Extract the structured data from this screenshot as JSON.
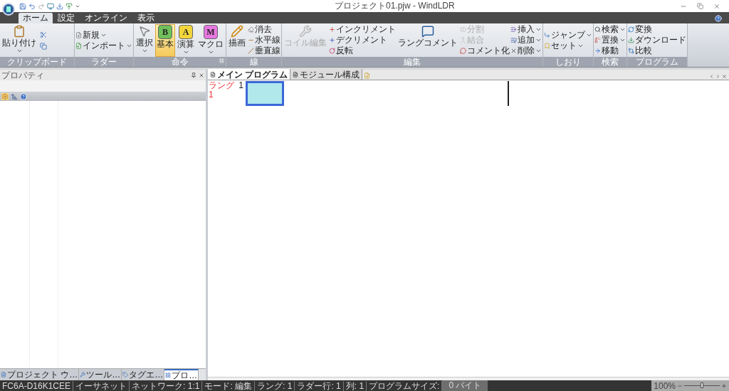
{
  "window": {
    "title": "プロジェクト01.pjw - WindLDR"
  },
  "tabs": [
    {
      "label": "ホーム",
      "selected": true
    },
    {
      "label": "設定",
      "selected": false
    },
    {
      "label": "オンライン",
      "selected": false
    },
    {
      "label": "表示",
      "selected": false
    }
  ],
  "ribbon": [
    {
      "label": "クリップボード",
      "launcher": false,
      "columns": [
        [
          {
            "kind": "large",
            "label": "貼り付け",
            "dropdown": true,
            "disabled": false,
            "selected": false
          }
        ],
        [
          {
            "kind": "icon",
            "disabled": false,
            "selected": false
          },
          {
            "kind": "icon",
            "disabled": false,
            "selected": false
          }
        ]
      ]
    },
    {
      "label": "ラダー",
      "launcher": false,
      "columns": [
        [
          {
            "kind": "small",
            "label": "新規",
            "dropdown": true,
            "disabled": false,
            "selected": false
          },
          {
            "kind": "small",
            "label": "インポート",
            "dropdown": true,
            "disabled": false,
            "selected": false
          }
        ]
      ]
    },
    {
      "label": "命令",
      "launcher": true,
      "columns": [
        [
          {
            "kind": "large",
            "label": "選択",
            "dropdown": true,
            "disabled": false,
            "selected": false
          }
        ],
        [
          {
            "kind": "large",
            "label": "基本",
            "glyph": "B",
            "color": "#6fbf5a",
            "dropdown": false,
            "disabled": false,
            "selected": true
          }
        ],
        [
          {
            "kind": "large",
            "label": "演算",
            "glyph": "A",
            "color": "#f2d53c",
            "dropdown": true,
            "disabled": false,
            "selected": false
          }
        ],
        [
          {
            "kind": "large",
            "label": "マクロ",
            "glyph": "M",
            "color": "#e777e0",
            "dropdown": true,
            "disabled": false,
            "selected": false
          }
        ]
      ]
    },
    {
      "label": "線",
      "launcher": false,
      "columns": [
        [
          {
            "kind": "large",
            "label": "描画",
            "dropdown": false,
            "disabled": false,
            "selected": false
          }
        ],
        [
          {
            "kind": "small",
            "label": "消去",
            "dropdown": false,
            "disabled": false,
            "selected": false
          },
          {
            "kind": "small",
            "label": "水平線",
            "dropdown": false,
            "disabled": false,
            "selected": false
          },
          {
            "kind": "small",
            "label": "垂直線",
            "dropdown": false,
            "disabled": false,
            "selected": false
          }
        ]
      ]
    },
    {
      "label": "編集",
      "launcher": false,
      "columns": [
        [
          {
            "kind": "large",
            "label": "コイル編集",
            "dropdown": false,
            "disabled": true,
            "selected": false
          }
        ],
        [
          {
            "kind": "small",
            "label": "インクリメント",
            "dropdown": false,
            "disabled": false,
            "selected": false
          },
          {
            "kind": "small",
            "label": "デクリメント",
            "dropdown": false,
            "disabled": false,
            "selected": false
          },
          {
            "kind": "small",
            "label": "反転",
            "dropdown": false,
            "disabled": false,
            "selected": false
          }
        ],
        [
          {
            "kind": "large",
            "label": "ラングコメント",
            "dropdown": false,
            "disabled": false,
            "selected": false
          }
        ],
        [
          {
            "kind": "small",
            "label": "分割",
            "dropdown": false,
            "disabled": true,
            "selected": false
          },
          {
            "kind": "small",
            "label": "結合",
            "dropdown": false,
            "disabled": true,
            "selected": false
          },
          {
            "kind": "small",
            "label": "コメント化",
            "dropdown": false,
            "disabled": false,
            "selected": false
          }
        ],
        [
          {
            "kind": "small",
            "label": "挿入",
            "dropdown": true,
            "disabled": false,
            "selected": false
          },
          {
            "kind": "small",
            "label": "追加",
            "dropdown": true,
            "disabled": false,
            "selected": false
          },
          {
            "kind": "small",
            "label": "削除",
            "dropdown": true,
            "disabled": false,
            "selected": false
          }
        ]
      ]
    },
    {
      "label": "しおり",
      "launcher": false,
      "columns": [
        [
          {
            "kind": "small",
            "label": "ジャンプ",
            "dropdown": true,
            "disabled": false,
            "selected": false
          },
          {
            "kind": "small",
            "label": "セット",
            "dropdown": true,
            "disabled": false,
            "selected": false
          }
        ]
      ]
    },
    {
      "label": "検索",
      "launcher": false,
      "columns": [
        [
          {
            "kind": "small",
            "label": "検索",
            "dropdown": true,
            "disabled": false,
            "selected": false
          },
          {
            "kind": "small",
            "label": "置換",
            "dropdown": true,
            "disabled": false,
            "selected": false
          },
          {
            "kind": "small",
            "label": "移動",
            "dropdown": false,
            "disabled": false,
            "selected": false
          }
        ]
      ]
    },
    {
      "label": "プログラム",
      "launcher": false,
      "columns": [
        [
          {
            "kind": "small",
            "label": "変換",
            "dropdown": false,
            "disabled": false,
            "selected": false
          },
          {
            "kind": "small",
            "label": "ダウンロード",
            "dropdown": false,
            "disabled": false,
            "selected": false
          },
          {
            "kind": "small",
            "label": "比較",
            "dropdown": false,
            "disabled": false,
            "selected": false
          }
        ]
      ]
    }
  ],
  "properties_panel": {
    "title": "プロパティ",
    "bottom_tabs": [
      {
        "label": "プロジェクト ウ…",
        "selected": false
      },
      {
        "label": "ツール…",
        "selected": false
      },
      {
        "label": "タグエ…",
        "selected": false
      },
      {
        "label": "プロ…",
        "selected": true
      }
    ]
  },
  "editor": {
    "tabs": [
      {
        "label": "メイン プログラム",
        "selected": true
      },
      {
        "label": "モジュール構成",
        "selected": false
      }
    ],
    "rung_header": "ラング",
    "rung_number": "1",
    "line_number": "1"
  },
  "status_bar": {
    "items": [
      "FC6A-D16K1CEE",
      "イーサネット",
      "ネットワーク: 1:1",
      "モード: 編集",
      "ラング: 1",
      "ラダー行: 1",
      "列: 1",
      "プログラムサイズ:"
    ],
    "program_size": "0 バイト",
    "zoom": "100%",
    "zoom_slider": {
      "level": 0.5
    }
  }
}
